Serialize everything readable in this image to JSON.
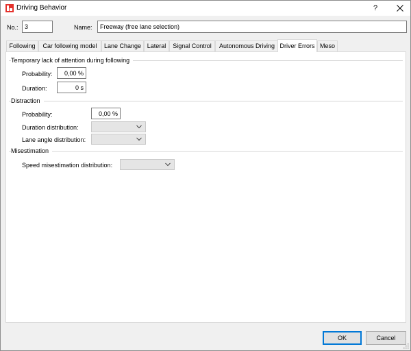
{
  "window": {
    "title": "Driving Behavior",
    "help_glyph": "?",
    "close_glyph": "✕",
    "accent": "#e4312b"
  },
  "header": {
    "no_label": "No.:",
    "no_value": "3",
    "name_label": "Name:",
    "name_value": "Freeway (free lane selection)"
  },
  "tabs": [
    {
      "label": "Following"
    },
    {
      "label": "Car following model"
    },
    {
      "label": "Lane Change"
    },
    {
      "label": "Lateral"
    },
    {
      "label": "Signal Control"
    },
    {
      "label": "Autonomous Driving"
    },
    {
      "label": "Driver Errors",
      "active": true
    },
    {
      "label": "Meso"
    }
  ],
  "temp_lack": {
    "title": "Temporary lack of attention during following",
    "probability_label": "Probability:",
    "probability_value": "0,00 %",
    "duration_label": "Duration:",
    "duration_value": "0 s"
  },
  "distraction": {
    "title": "Distraction",
    "probability_label": "Probability:",
    "probability_value": "0,00 %",
    "duration_dist_label": "Duration distribution:",
    "duration_dist_value": "",
    "lane_angle_label": "Lane angle distribution:",
    "lane_angle_value": ""
  },
  "misestimation": {
    "title": "Misestimation",
    "speed_label": "Speed misestimation distribution:",
    "speed_value": ""
  },
  "footer": {
    "ok_label": "OK",
    "cancel_label": "Cancel"
  },
  "icons": {
    "app": "vissim-app-icon",
    "chevron": "chevron-down-icon",
    "grip": "resize-grip-icon"
  }
}
